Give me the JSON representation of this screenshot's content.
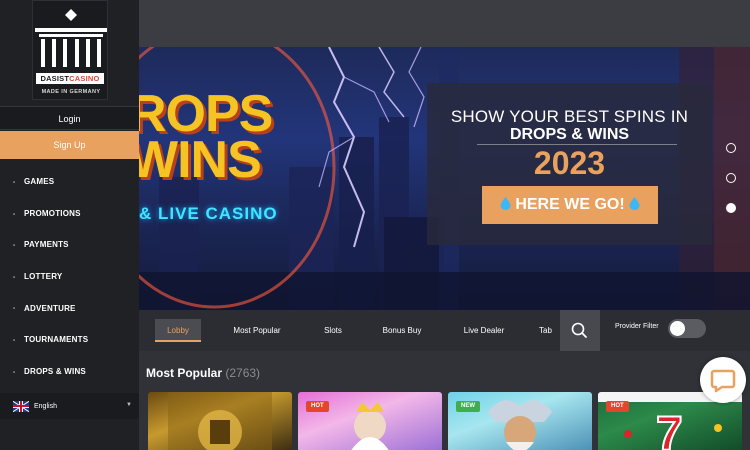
{
  "brand": {
    "name_part1": "DASIST",
    "name_part2": "CASINO",
    "tagline": "MADE IN GERMANY"
  },
  "auth": {
    "login_label": "Login",
    "signup_label": "Sign Up"
  },
  "nav": {
    "items": [
      {
        "label": "GAMES"
      },
      {
        "label": "PROMOTIONS"
      },
      {
        "label": "PAYMENTS"
      },
      {
        "label": "LOTTERY"
      },
      {
        "label": "ADVENTURE"
      },
      {
        "label": "TOURNAMENTS"
      },
      {
        "label": "DROPS & WINS"
      }
    ]
  },
  "language": {
    "selected": "English",
    "flag_icon": "uk-flag-icon"
  },
  "hero": {
    "promo_line1": "ROPS",
    "promo_line2": "WINS",
    "promo_sub": "& LIVE CASINO",
    "headline": "SHOW YOUR BEST SPINS IN",
    "subheadline": "DROPS & WINS",
    "year": "2023",
    "cta_label": "HERE WE GO!",
    "slides_total": 3,
    "active_slide": 3
  },
  "tabs": {
    "items": [
      {
        "label": "Lobby",
        "active": true
      },
      {
        "label": "Most Popular",
        "active": false
      },
      {
        "label": "Slots",
        "active": false
      },
      {
        "label": "Bonus Buy",
        "active": false
      },
      {
        "label": "Live Dealer",
        "active": false
      },
      {
        "label": "Tab",
        "active": false
      }
    ],
    "provider_filter_label": "Provider Filter"
  },
  "popular": {
    "title": "Most Popular",
    "count": "(2763)",
    "cards": [
      {
        "badge": ""
      },
      {
        "badge": "HOT"
      },
      {
        "badge": "NEW"
      },
      {
        "badge": "HOT"
      }
    ]
  },
  "colors": {
    "accent": "#e8a15e",
    "sidebar_bg": "#1f2125",
    "page_bg": "#303237",
    "promo_yellow": "#f5c323",
    "hot_badge": "#e5462b",
    "new_badge": "#3fae4c"
  }
}
